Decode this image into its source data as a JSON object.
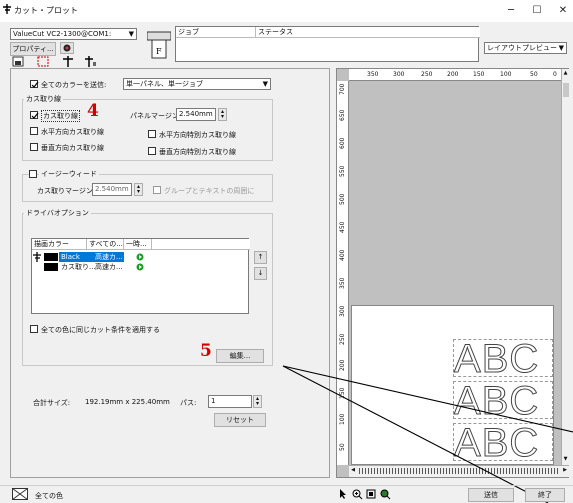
{
  "window": {
    "title": "カット・プロット",
    "minimize": "─",
    "maximize": "☐",
    "close": "✕"
  },
  "top": {
    "device_combo": "ValueCut VC2-1300@COM1:",
    "properties_button": "プロパティ...",
    "job_header": "ジョブ",
    "status_header": "ステータス",
    "preview_combo": "レイアウトプレビュー"
  },
  "options": {
    "send_all_colors_label": "全てのカラーを送信:",
    "send_mode_combo": "単一パネル、単一ジョブ",
    "weed_group_title": "カス取り線",
    "weed_lines_label": "カス取り線",
    "horizontal_weed_label": "水平方向カス取り線",
    "vertical_weed_label": "垂直方向カス取り線",
    "panel_margin_label": "パネルマージン:",
    "panel_margin_value": "2.540mm",
    "horizontal_special_label": "水平方向特別カス取り線",
    "vertical_special_label": "垂直方向特別カス取り線",
    "easyweed_label": "イージーウィード",
    "weed_margin_label": "カス取りマージン:",
    "weed_margin_value": "2.540mm",
    "group_text_label": "グループとテキストの周囲に",
    "driver_group_title": "ドライバオプション",
    "apply_same_label": "全ての色に同じカット条件を適用する",
    "edit_button": "編集...",
    "total_size_label": "合計サイズ:",
    "total_size_value": "192.19mm x 225.40mm",
    "pass_label": "パス:",
    "pass_value": "1",
    "reset_button": "リセット"
  },
  "color_table": {
    "headers": [
      "描画カラー",
      "すべての...",
      "一時..."
    ],
    "rows": [
      {
        "name": "Black",
        "mode": "高速カ...",
        "swatch": "#000000",
        "selected": true
      },
      {
        "name": "カス取り...",
        "mode": "高速カ...",
        "swatch": "#000000",
        "selected": false
      }
    ],
    "up_arrow": "↑",
    "down_arrow": "↓"
  },
  "annotations": {
    "step4": "4",
    "step5": "5"
  },
  "ruler": {
    "top_ticks": [
      "350",
      "300",
      "250",
      "200",
      "150",
      "100",
      "50",
      "0"
    ],
    "left_ticks": [
      "700",
      "650",
      "600",
      "550",
      "500",
      "450",
      "400",
      "350",
      "300",
      "250",
      "200",
      "150",
      "100",
      "50"
    ]
  },
  "preview": {
    "letters": [
      "A",
      "B",
      "C"
    ]
  },
  "footer": {
    "all_colors_label": "全ての色",
    "send_button": "送信",
    "finish_button": "終了"
  },
  "colors": {
    "accent_red": "#d00000",
    "selection_blue": "#0078d7",
    "preview_bg": "#c0c0c0"
  }
}
